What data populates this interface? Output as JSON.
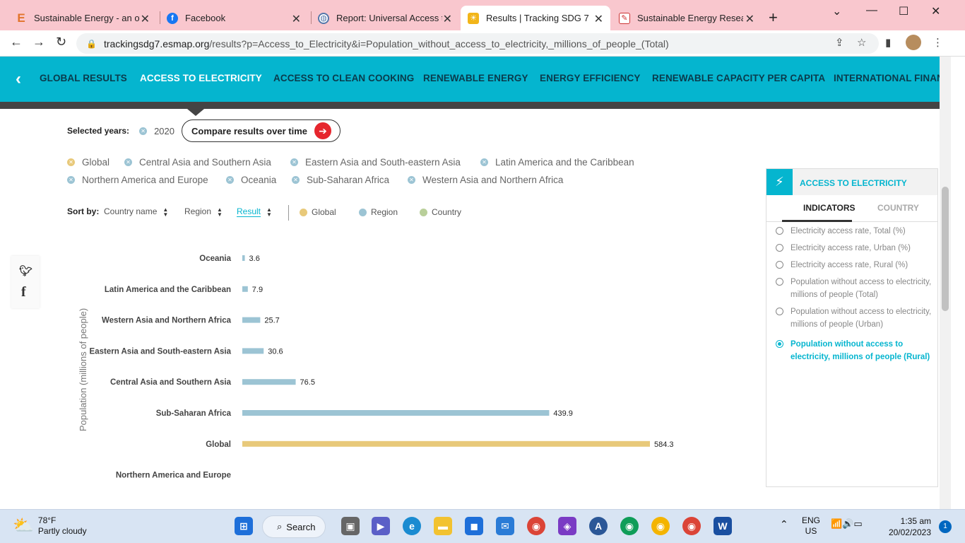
{
  "browser": {
    "tabs": [
      {
        "title": "Sustainable Energy - an over",
        "icon": "e-logo-icon",
        "active": false
      },
      {
        "title": "Facebook",
        "icon": "facebook-icon",
        "active": false
      },
      {
        "title": "Report: Universal Access to S",
        "icon": "globe-icon",
        "active": false
      },
      {
        "title": "Results | Tracking SDG 7",
        "icon": "sdg-icon",
        "active": true
      },
      {
        "title": "Sustainable Energy Research",
        "icon": "research-icon",
        "active": false
      }
    ],
    "url_host": "trackingsdg7.esmap.org",
    "url_path": "/results?p=Access_to_Electricity&i=Population_without_access_to_electricity,_millions_of_people_(Total)"
  },
  "nav": {
    "items": [
      "GLOBAL RESULTS",
      "ACCESS TO ELECTRICITY",
      "ACCESS TO CLEAN COOKING",
      "RENEWABLE ENERGY",
      "ENERGY EFFICIENCY",
      "RENEWABLE CAPACITY PER CAPITA",
      "INTERNATIONAL FINANC"
    ],
    "active_index": 1
  },
  "filters": {
    "selected_years_label": "Selected years:",
    "year": "2020",
    "compare_label": "Compare results over time",
    "regions": [
      "Global",
      "Central Asia and Southern Asia",
      "Eastern Asia and South-eastern Asia",
      "Latin America and the Caribbean",
      "Northern America and Europe",
      "Oceania",
      "Sub-Saharan Africa",
      "Western Asia and Northern Africa"
    ]
  },
  "sort": {
    "label": "Sort by:",
    "options": [
      "Country name",
      "Region",
      "Result"
    ],
    "active": "Result",
    "legend": [
      {
        "label": "Global",
        "color": "#e8c97a"
      },
      {
        "label": "Region",
        "color": "#9cc4d4"
      },
      {
        "label": "Country",
        "color": "#b9cf9a"
      }
    ]
  },
  "chart_data": {
    "type": "bar",
    "orientation": "horizontal",
    "ylabel": "Population (millions of people)",
    "categories": [
      "Oceania",
      "Latin America and the Caribbean",
      "Western Asia and Northern Africa",
      "Eastern Asia and South-eastern Asia",
      "Central Asia and Southern Asia",
      "Sub-Saharan Africa",
      "Global",
      "Northern America and Europe"
    ],
    "values": [
      3.6,
      7.9,
      25.7,
      30.6,
      76.5,
      439.9,
      584.3,
      null
    ],
    "labels": [
      "3.6",
      "7.9",
      "25.7",
      "30.6",
      "76.5",
      "439.9",
      "584.3",
      ""
    ],
    "kinds": [
      "region",
      "region",
      "region",
      "region",
      "region",
      "region",
      "global",
      "region"
    ],
    "colors": {
      "region": "#9cc4d4",
      "global": "#e8c97a"
    },
    "xlim": [
      0,
      584.3
    ]
  },
  "panel": {
    "title": "ACCESS TO ELECTRICITY",
    "tabs": [
      "INDICATORS",
      "COUNTRY"
    ],
    "active_tab": "INDICATORS",
    "options": [
      "Electricity access rate, Total (%)",
      "Electricity access rate, Urban (%)",
      "Electricity access rate, Rural (%)",
      "Population without access to electricity, millions of people (Total)",
      "Population without access to electricity, millions of people (Urban)",
      "Population without access to electricity, millions of people (Rural)"
    ],
    "selected_index": 5
  },
  "taskbar": {
    "temp": "78°F",
    "weather": "Partly cloudy",
    "search": "Search",
    "lang1": "ENG",
    "lang2": "US",
    "time": "1:35 am",
    "date": "20/02/2023",
    "notifications": "1"
  }
}
